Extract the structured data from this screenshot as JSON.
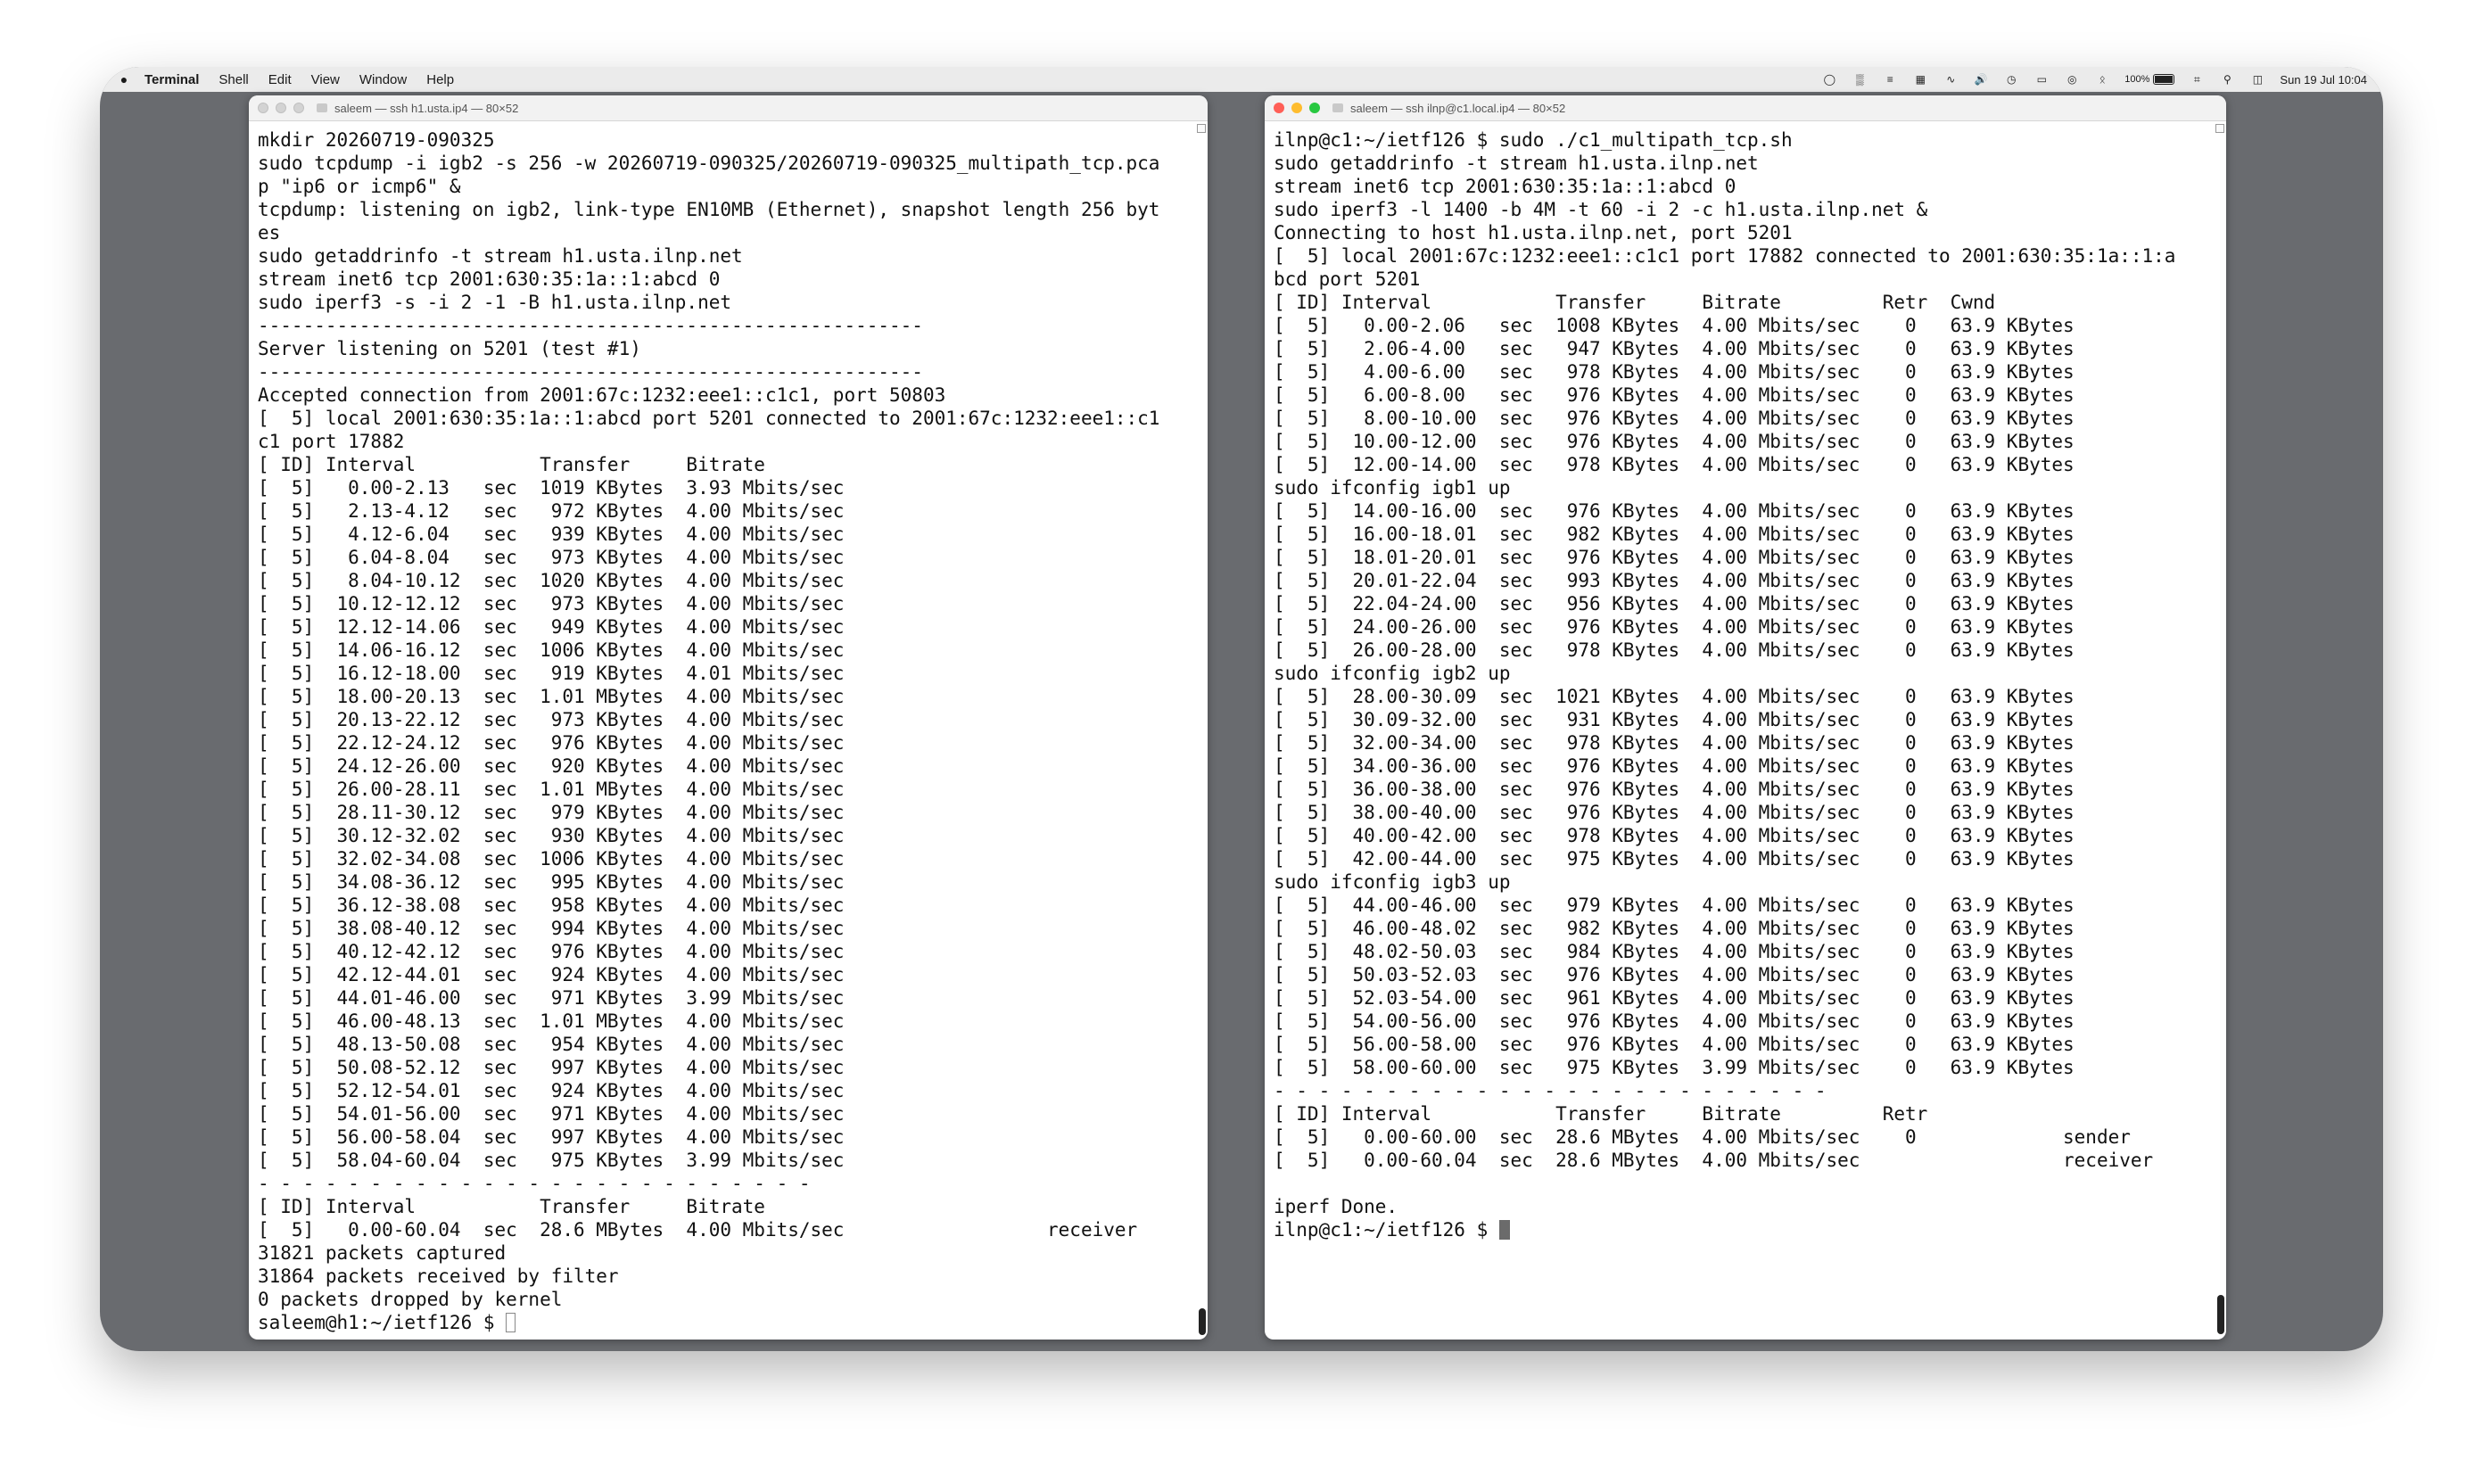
{
  "menubar": {
    "apple_icon": "apple-logo",
    "items": [
      "Terminal",
      "Shell",
      "Edit",
      "View",
      "Window",
      "Help"
    ],
    "battery_percent": "100%",
    "clock": "Sun 19 Jul  10:04"
  },
  "left_window": {
    "title": "saleem — ssh h1.usta.ip4 — 80×52",
    "lines": [
      "mkdir 20260719-090325",
      "sudo tcpdump -i igb2 -s 256 -w 20260719-090325/20260719-090325_multipath_tcp.pca",
      "p \"ip6 or icmp6\" &",
      "tcpdump: listening on igb2, link-type EN10MB (Ethernet), snapshot length 256 byt",
      "es",
      "sudo getaddrinfo -t stream h1.usta.ilnp.net",
      "stream inet6 tcp 2001:630:35:1a::1:abcd 0",
      "sudo iperf3 -s -i 2 -1 -B h1.usta.ilnp.net",
      "-----------------------------------------------------------",
      "Server listening on 5201 (test #1)",
      "-----------------------------------------------------------",
      "Accepted connection from 2001:67c:1232:eee1::c1c1, port 50803",
      "[  5] local 2001:630:35:1a::1:abcd port 5201 connected to 2001:67c:1232:eee1::c1",
      "c1 port 17882",
      "[ ID] Interval           Transfer     Bitrate",
      "[  5]   0.00-2.13   sec  1019 KBytes  3.93 Mbits/sec",
      "[  5]   2.13-4.12   sec   972 KBytes  4.00 Mbits/sec",
      "[  5]   4.12-6.04   sec   939 KBytes  4.00 Mbits/sec",
      "[  5]   6.04-8.04   sec   973 KBytes  4.00 Mbits/sec",
      "[  5]   8.04-10.12  sec  1020 KBytes  4.00 Mbits/sec",
      "[  5]  10.12-12.12  sec   973 KBytes  4.00 Mbits/sec",
      "[  5]  12.12-14.06  sec   949 KBytes  4.00 Mbits/sec",
      "[  5]  14.06-16.12  sec  1006 KBytes  4.00 Mbits/sec",
      "[  5]  16.12-18.00  sec   919 KBytes  4.01 Mbits/sec",
      "[  5]  18.00-20.13  sec  1.01 MBytes  4.00 Mbits/sec",
      "[  5]  20.13-22.12  sec   973 KBytes  4.00 Mbits/sec",
      "[  5]  22.12-24.12  sec   976 KBytes  4.00 Mbits/sec",
      "[  5]  24.12-26.00  sec   920 KBytes  4.00 Mbits/sec",
      "[  5]  26.00-28.11  sec  1.01 MBytes  4.00 Mbits/sec",
      "[  5]  28.11-30.12  sec   979 KBytes  4.00 Mbits/sec",
      "[  5]  30.12-32.02  sec   930 KBytes  4.00 Mbits/sec",
      "[  5]  32.02-34.08  sec  1006 KBytes  4.00 Mbits/sec",
      "[  5]  34.08-36.12  sec   995 KBytes  4.00 Mbits/sec",
      "[  5]  36.12-38.08  sec   958 KBytes  4.00 Mbits/sec",
      "[  5]  38.08-40.12  sec   994 KBytes  4.00 Mbits/sec",
      "[  5]  40.12-42.12  sec   976 KBytes  4.00 Mbits/sec",
      "[  5]  42.12-44.01  sec   924 KBytes  4.00 Mbits/sec",
      "[  5]  44.01-46.00  sec   971 KBytes  3.99 Mbits/sec",
      "[  5]  46.00-48.13  sec  1.01 MBytes  4.00 Mbits/sec",
      "[  5]  48.13-50.08  sec   954 KBytes  4.00 Mbits/sec",
      "[  5]  50.08-52.12  sec   997 KBytes  4.00 Mbits/sec",
      "[  5]  52.12-54.01  sec   924 KBytes  4.00 Mbits/sec",
      "[  5]  54.01-56.00  sec   971 KBytes  4.00 Mbits/sec",
      "[  5]  56.00-58.04  sec   997 KBytes  4.00 Mbits/sec",
      "[  5]  58.04-60.04  sec   975 KBytes  3.99 Mbits/sec",
      "- - - - - - - - - - - - - - - - - - - - - - - - -",
      "[ ID] Interval           Transfer     Bitrate",
      "[  5]   0.00-60.04  sec  28.6 MBytes  4.00 Mbits/sec                  receiver",
      "31821 packets captured",
      "31864 packets received by filter",
      "0 packets dropped by kernel"
    ],
    "prompt": "saleem@h1:~/ietf126 $ "
  },
  "right_window": {
    "title": "saleem — ssh ilnp@c1.local.ip4 — 80×52",
    "lines": [
      "ilnp@c1:~/ietf126 $ sudo ./c1_multipath_tcp.sh",
      "sudo getaddrinfo -t stream h1.usta.ilnp.net",
      "stream inet6 tcp 2001:630:35:1a::1:abcd 0",
      "sudo iperf3 -l 1400 -b 4M -t 60 -i 2 -c h1.usta.ilnp.net &",
      "Connecting to host h1.usta.ilnp.net, port 5201",
      "[  5] local 2001:67c:1232:eee1::c1c1 port 17882 connected to 2001:630:35:1a::1:a",
      "bcd port 5201",
      "[ ID] Interval           Transfer     Bitrate         Retr  Cwnd",
      "[  5]   0.00-2.06   sec  1008 KBytes  4.00 Mbits/sec    0   63.9 KBytes",
      "[  5]   2.06-4.00   sec   947 KBytes  4.00 Mbits/sec    0   63.9 KBytes",
      "[  5]   4.00-6.00   sec   978 KBytes  4.00 Mbits/sec    0   63.9 KBytes",
      "[  5]   6.00-8.00   sec   976 KBytes  4.00 Mbits/sec    0   63.9 KBytes",
      "[  5]   8.00-10.00  sec   976 KBytes  4.00 Mbits/sec    0   63.9 KBytes",
      "[  5]  10.00-12.00  sec   976 KBytes  4.00 Mbits/sec    0   63.9 KBytes",
      "[  5]  12.00-14.00  sec   978 KBytes  4.00 Mbits/sec    0   63.9 KBytes",
      "sudo ifconfig igb1 up",
      "[  5]  14.00-16.00  sec   976 KBytes  4.00 Mbits/sec    0   63.9 KBytes",
      "[  5]  16.00-18.01  sec   982 KBytes  4.00 Mbits/sec    0   63.9 KBytes",
      "[  5]  18.01-20.01  sec   976 KBytes  4.00 Mbits/sec    0   63.9 KBytes",
      "[  5]  20.01-22.04  sec   993 KBytes  4.00 Mbits/sec    0   63.9 KBytes",
      "[  5]  22.04-24.00  sec   956 KBytes  4.00 Mbits/sec    0   63.9 KBytes",
      "[  5]  24.00-26.00  sec   976 KBytes  4.00 Mbits/sec    0   63.9 KBytes",
      "[  5]  26.00-28.00  sec   978 KBytes  4.00 Mbits/sec    0   63.9 KBytes",
      "sudo ifconfig igb2 up",
      "[  5]  28.00-30.09  sec  1021 KBytes  4.00 Mbits/sec    0   63.9 KBytes",
      "[  5]  30.09-32.00  sec   931 KBytes  4.00 Mbits/sec    0   63.9 KBytes",
      "[  5]  32.00-34.00  sec   978 KBytes  4.00 Mbits/sec    0   63.9 KBytes",
      "[  5]  34.00-36.00  sec   976 KBytes  4.00 Mbits/sec    0   63.9 KBytes",
      "[  5]  36.00-38.00  sec   976 KBytes  4.00 Mbits/sec    0   63.9 KBytes",
      "[  5]  38.00-40.00  sec   976 KBytes  4.00 Mbits/sec    0   63.9 KBytes",
      "[  5]  40.00-42.00  sec   978 KBytes  4.00 Mbits/sec    0   63.9 KBytes",
      "[  5]  42.00-44.00  sec   975 KBytes  4.00 Mbits/sec    0   63.9 KBytes",
      "sudo ifconfig igb3 up",
      "[  5]  44.00-46.00  sec   979 KBytes  4.00 Mbits/sec    0   63.9 KBytes",
      "[  5]  46.00-48.02  sec   982 KBytes  4.00 Mbits/sec    0   63.9 KBytes",
      "[  5]  48.02-50.03  sec   984 KBytes  4.00 Mbits/sec    0   63.9 KBytes",
      "[  5]  50.03-52.03  sec   976 KBytes  4.00 Mbits/sec    0   63.9 KBytes",
      "[  5]  52.03-54.00  sec   961 KBytes  4.00 Mbits/sec    0   63.9 KBytes",
      "[  5]  54.00-56.00  sec   976 KBytes  4.00 Mbits/sec    0   63.9 KBytes",
      "[  5]  56.00-58.00  sec   976 KBytes  4.00 Mbits/sec    0   63.9 KBytes",
      "[  5]  58.00-60.00  sec   975 KBytes  3.99 Mbits/sec    0   63.9 KBytes",
      "- - - - - - - - - - - - - - - - - - - - - - - - -",
      "[ ID] Interval           Transfer     Bitrate         Retr",
      "[  5]   0.00-60.00  sec  28.6 MBytes  4.00 Mbits/sec    0             sender",
      "[  5]   0.00-60.04  sec  28.6 MBytes  4.00 Mbits/sec                  receiver",
      "",
      "iperf Done."
    ],
    "prompt": "ilnp@c1:~/ietf126 $ "
  }
}
